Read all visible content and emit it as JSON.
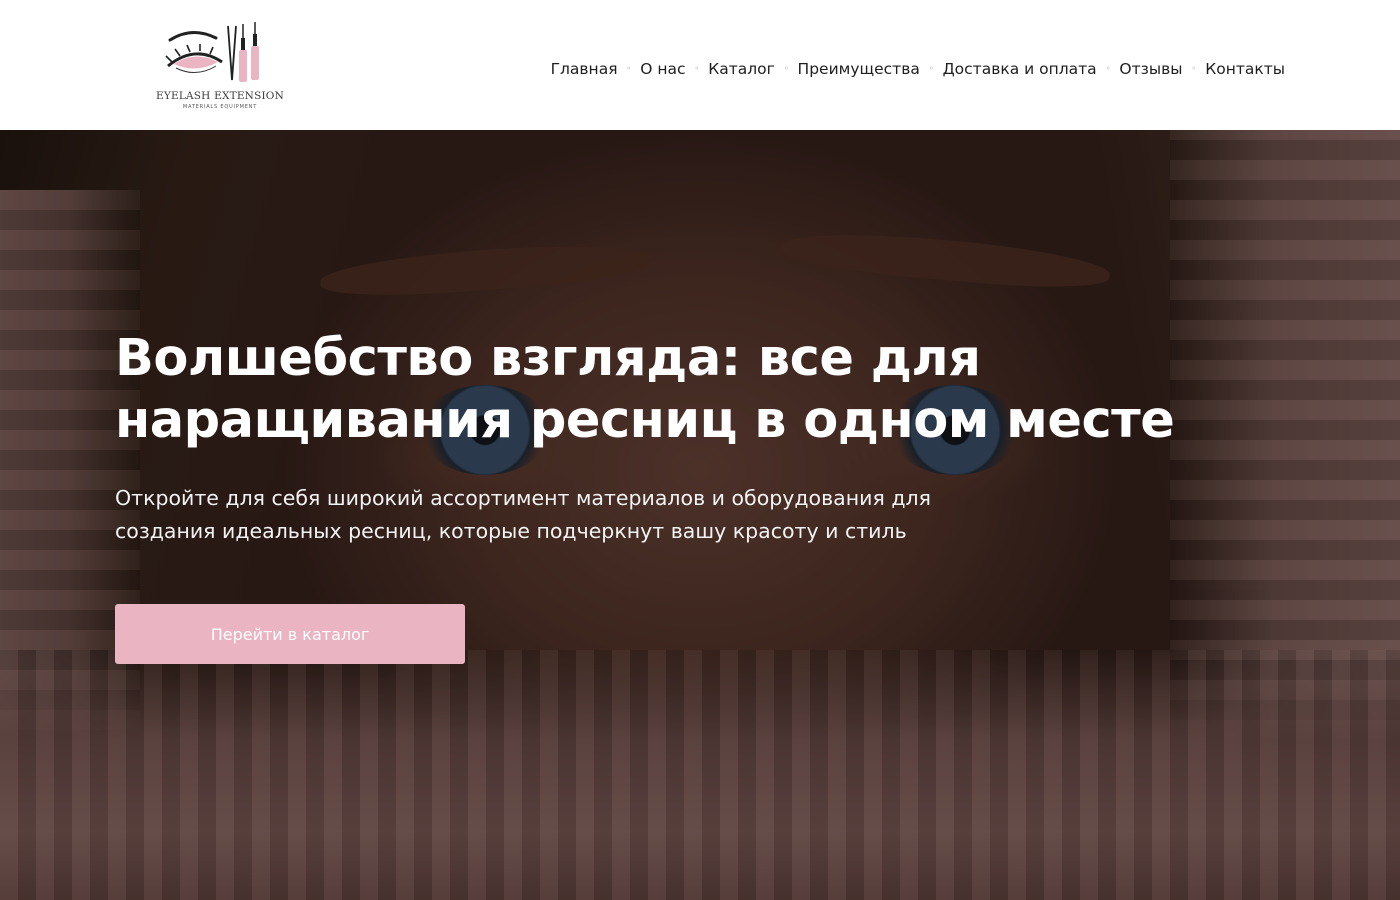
{
  "header": {
    "logo": {
      "title": "EYELASH EXTENSION",
      "subtitle": "MATERIALS EQUIPMENT",
      "accent_color": "#ebb4c3"
    },
    "nav": [
      {
        "label": "Главная"
      },
      {
        "label": "О нас"
      },
      {
        "label": "Каталог"
      },
      {
        "label": "Преимущества"
      },
      {
        "label": "Доставка и оплата"
      },
      {
        "label": "Отзывы"
      },
      {
        "label": "Контакты"
      }
    ],
    "nav_separator": "◦"
  },
  "hero": {
    "title": "Волшебство взгляда: все для наращивания ресниц в одном месте",
    "subtitle": "Откройте для себя широкий ассортимент материалов и оборудования для создания идеальных ресниц, которые подчеркнут вашу красоту и стиль",
    "cta_label": "Перейти в каталог",
    "cta_color": "#ebb4c3"
  }
}
